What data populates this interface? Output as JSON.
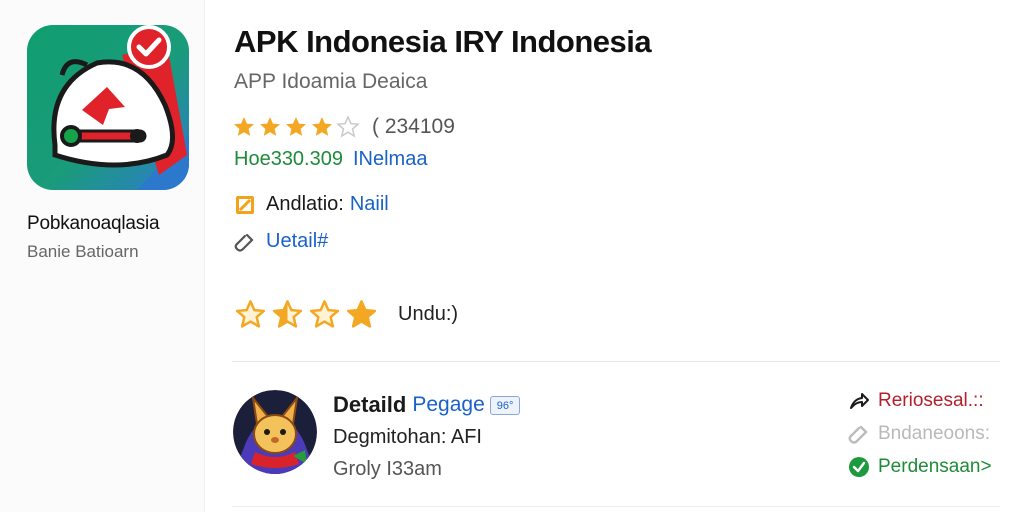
{
  "developer": {
    "name": "Pobkanoaqlasia",
    "subtitle": "Banie Batioarn"
  },
  "app": {
    "title": "APK Indonesia IRY Indonesia",
    "subtitle": "APP Idoamia Deaica",
    "rating_stars": 4,
    "rating_count": "( 234109",
    "meta_left": "Hoe330.309",
    "meta_right": "INelmaa"
  },
  "info": {
    "android_label": "Andlatio:",
    "android_value": "Naiil",
    "detail_link": "Uetail#"
  },
  "big_rating": {
    "stars": 4,
    "label": "Undu:)"
  },
  "detail": {
    "title": "Detaild",
    "link": "Pegage",
    "badge": "96°",
    "line2": "Degmitohan: AFI",
    "line3": "Groly I33am"
  },
  "actions": [
    {
      "label": "Reriosesal.::",
      "icon": "share-icon",
      "color": "#b31f2a"
    },
    {
      "label": "Bndaneoons:",
      "icon": "link-icon",
      "color": "#b9b9b9"
    },
    {
      "label": "Perdensaan>",
      "icon": "check-icon",
      "color": "#1e8b3a"
    }
  ],
  "colors": {
    "accent_blue": "#1a62c8",
    "accent_green": "#1e8b3a",
    "accent_red": "#b31f2a",
    "star": "#f4a723",
    "icon_bg": "#1b9a6a"
  }
}
